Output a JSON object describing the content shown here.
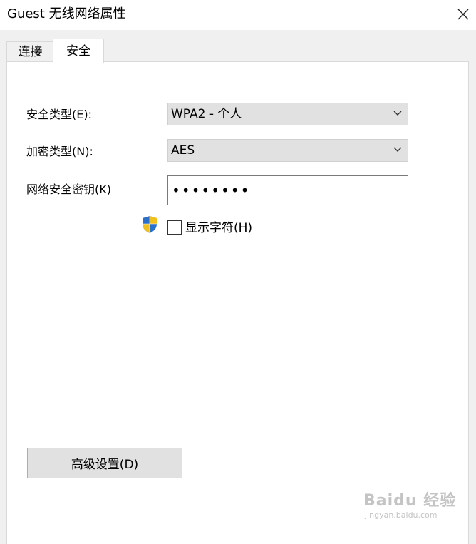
{
  "window": {
    "title": "Guest 无线网络属性",
    "close_icon": "close-icon"
  },
  "tabs": [
    {
      "label": "连接",
      "active": false
    },
    {
      "label": "安全",
      "active": true
    }
  ],
  "security": {
    "security_type_label": "安全类型(E):",
    "security_type_value": "WPA2 - 个人",
    "encryption_type_label": "加密类型(N):",
    "encryption_type_value": "AES",
    "network_key_label": "网络安全密钥(K)",
    "network_key_value": "••••••••",
    "show_chars_label": "显示字符(H)",
    "show_chars_checked": false,
    "shield_icon": "uac-shield-icon"
  },
  "advanced_button_label": "高级设置(D)",
  "watermark": {
    "brand": "Baidu 经验",
    "url": "jingyan.baidu.com"
  }
}
